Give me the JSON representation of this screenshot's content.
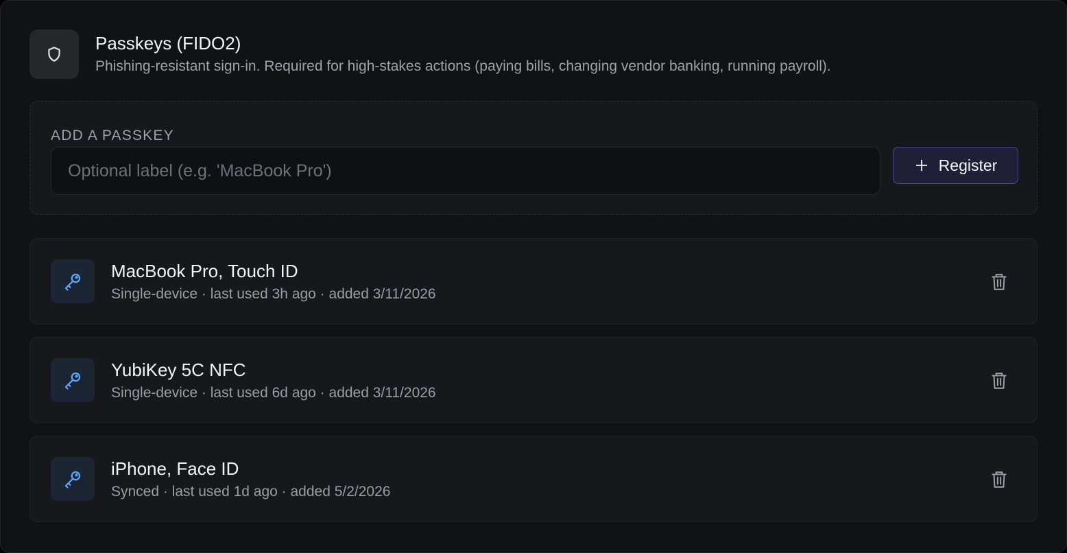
{
  "header": {
    "icon": "shield-icon",
    "title": "Passkeys (FIDO2)",
    "subtitle": "Phishing-resistant sign-in. Required for high-stakes actions (paying bills, changing vendor banking, running payroll)."
  },
  "add": {
    "section_label": "ADD A PASSKEY",
    "input_value": "",
    "input_placeholder": "Optional label (e.g. 'MacBook Pro')",
    "register_label": "Register",
    "register_icon": "plus-icon"
  },
  "passkeys": [
    {
      "name": "MacBook Pro, Touch ID",
      "meta": "Single-device · last used 3h ago · added 3/11/2026",
      "icon": "key-icon",
      "action_icon": "trash-icon"
    },
    {
      "name": "YubiKey 5C NFC",
      "meta": "Single-device · last used 6d ago · added 3/11/2026",
      "icon": "key-icon",
      "action_icon": "trash-icon"
    },
    {
      "name": "iPhone, Face ID",
      "meta": "Synced · last used 1d ago · added 5/2/2026",
      "icon": "key-icon",
      "action_icon": "trash-icon"
    }
  ],
  "colors": {
    "background": "#111214",
    "panel": "#17181b",
    "accent": "#1f2038",
    "accent_border": "#4a4d8a",
    "key_icon": "#60a5fa"
  }
}
